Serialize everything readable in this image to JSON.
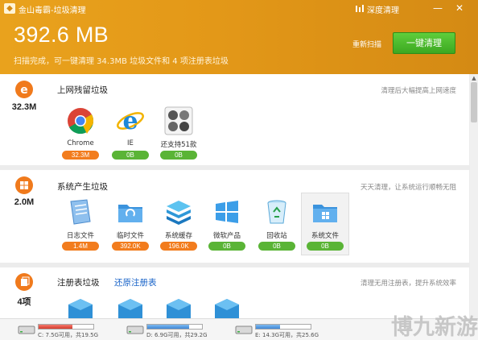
{
  "titlebar": {
    "title": "金山毒霸-垃圾清理",
    "deep_clean": "深度清理",
    "minimize": "—",
    "close": "✕"
  },
  "summary": {
    "size": "392.6 MB",
    "status": "扫描完成，可一键清理 34.3MB 垃圾文件和 4 项注册表垃圾",
    "rescan": "重新扫描",
    "clean_button": "一键清理"
  },
  "categories": [
    {
      "size": "32.3M",
      "title": "上网残留垃圾",
      "hint": "清理后大幅提高上网速度",
      "items": [
        {
          "label": "Chrome",
          "amount": "32.3M",
          "status": "orange",
          "icon": "chrome-icon"
        },
        {
          "label": "IE",
          "amount": "0B",
          "status": "green",
          "icon": "ie-icon"
        },
        {
          "label": "还支持51款",
          "amount": "0B",
          "status": "green",
          "icon": "more-browsers-icon"
        }
      ]
    },
    {
      "size": "2.0M",
      "title": "系统产生垃圾",
      "hint": "天天清理，让系统运行顺畅无阻",
      "items": [
        {
          "label": "日志文件",
          "amount": "1.4M",
          "status": "orange",
          "icon": "log-file-icon"
        },
        {
          "label": "临时文件",
          "amount": "392.0K",
          "status": "orange",
          "icon": "temp-folder-icon"
        },
        {
          "label": "系统缓存",
          "amount": "196.0K",
          "status": "orange",
          "icon": "system-cache-icon"
        },
        {
          "label": "微软产品",
          "amount": "0B",
          "status": "green",
          "icon": "windows-icon"
        },
        {
          "label": "回收站",
          "amount": "0B",
          "status": "green",
          "icon": "recycle-bin-icon"
        },
        {
          "label": "系统文件",
          "amount": "0B",
          "status": "green",
          "icon": "system-folder-icon"
        }
      ]
    },
    {
      "size": "4项",
      "title": "注册表垃圾",
      "link": "还原注册表",
      "hint": "清理无用注册表，提升系统效率"
    }
  ],
  "disks": [
    {
      "text": "C: 7.5G可用，共19.5G",
      "used_fraction": 0.62,
      "warn": true
    },
    {
      "text": "D: 6.9G可用，共29.2G",
      "used_fraction": 0.76,
      "warn": false
    },
    {
      "text": "E: 14.3G可用，共25.6G",
      "used_fraction": 0.44,
      "warn": false
    }
  ],
  "watermark": "博九新游",
  "colors": {
    "header": "#e39818",
    "clean_button": "#4cbb2c",
    "pill_orange": "#f27c1d",
    "pill_green": "#5ab436",
    "link": "#1a64c8"
  }
}
